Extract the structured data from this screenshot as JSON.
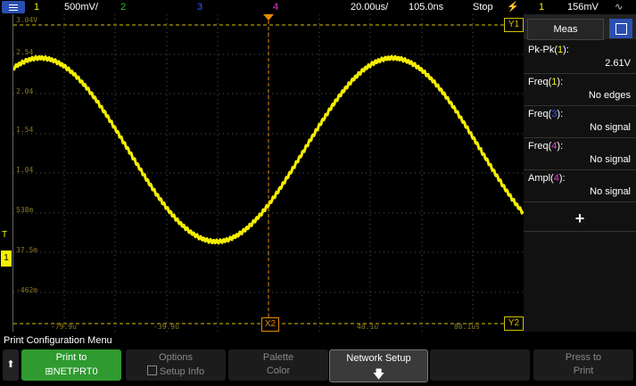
{
  "topbar": {
    "ch1_num": "1",
    "ch1_scale": "500mV/",
    "ch2_num": "2",
    "ch3_num": "3",
    "ch4_num": "4",
    "timebase": "20.00us/",
    "delay": "105.0ns",
    "run_state": "Stop",
    "trig_source": "1",
    "trig_level": "156mV",
    "colors": {
      "ch1": "#f5ef00",
      "ch2": "#22c022",
      "ch3": "#3a5cff",
      "ch4": "#e040d0"
    }
  },
  "graticule": {
    "volt_labels": [
      "3.04V",
      "2.54",
      "2.04",
      "1.54",
      "1.04",
      "538m",
      "37.5m",
      "-462m"
    ],
    "time_labels": [
      "-79.9u",
      "-39.9u",
      "40.1u",
      "80.1us"
    ],
    "marker_y1": "Y1",
    "marker_y2": "Y2",
    "marker_x2": "X2",
    "trigger_level_marker": "T",
    "ground_marker": "1"
  },
  "side_panel": {
    "tab_label": "Meas",
    "items": [
      {
        "name_pre": "Pk-Pk(",
        "name_ch": "1",
        "name_post": "):",
        "value": "2.61V",
        "ch_color": "#f5ef00"
      },
      {
        "name_pre": "Freq(",
        "name_ch": "1",
        "name_post": "):",
        "value": "No edges",
        "ch_color": "#f5ef00"
      },
      {
        "name_pre": "Freq(",
        "name_ch": "3",
        "name_post": "):",
        "value": "No signal",
        "ch_color": "#3a5cff"
      },
      {
        "name_pre": "Freq(",
        "name_ch": "4",
        "name_post": "):",
        "value": "No signal",
        "ch_color": "#e040d0"
      },
      {
        "name_pre": "Ampl(",
        "name_ch": "4",
        "name_post": "):",
        "value": "No signal",
        "ch_color": "#e040d0"
      }
    ],
    "add_label": "+"
  },
  "menu_title": "Print Configuration Menu",
  "softkeys": {
    "print_to_l1": "Print to",
    "print_to_l2": "NETPRT0",
    "options_l1": "Options",
    "options_l2": "Setup Info",
    "palette_l1": "Palette",
    "palette_l2": "Color",
    "network_l1": "Network Setup",
    "press_l1": "Press to",
    "press_l2": "Print"
  }
}
